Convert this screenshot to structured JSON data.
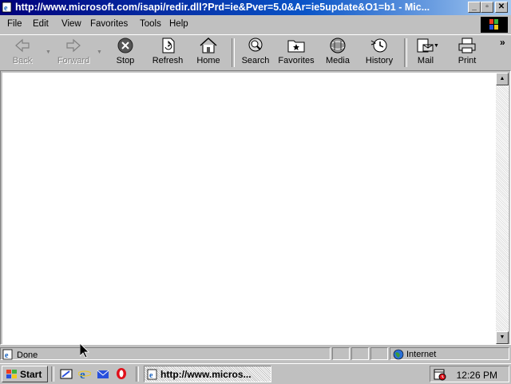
{
  "window": {
    "title": "http://www.microsoft.com/isapi/redir.dll?Prd=ie&Pver=5.0&Ar=ie5update&O1=b1 - Mic...",
    "controls": [
      "minimize",
      "maximize",
      "close"
    ]
  },
  "menu": {
    "items": [
      {
        "label": "File"
      },
      {
        "label": "Edit"
      },
      {
        "label": "View"
      },
      {
        "label": "Favorites"
      },
      {
        "label": "Tools"
      },
      {
        "label": "Help"
      }
    ]
  },
  "toolbar": {
    "buttons": [
      {
        "label": "Back",
        "icon": "back-arrow-icon",
        "enabled": false
      },
      {
        "label": "Forward",
        "icon": "forward-arrow-icon",
        "enabled": false
      },
      {
        "label": "Stop",
        "icon": "stop-icon",
        "enabled": true
      },
      {
        "label": "Refresh",
        "icon": "refresh-icon",
        "enabled": true
      },
      {
        "label": "Home",
        "icon": "home-icon",
        "enabled": true
      },
      {
        "label": "Search",
        "icon": "search-icon",
        "enabled": true
      },
      {
        "label": "Favorites",
        "icon": "favorites-folder-icon",
        "enabled": true
      },
      {
        "label": "Media",
        "icon": "media-icon",
        "enabled": true
      },
      {
        "label": "History",
        "icon": "history-icon",
        "enabled": true
      },
      {
        "label": "Mail",
        "icon": "mail-icon",
        "enabled": true
      },
      {
        "label": "Print",
        "icon": "print-icon",
        "enabled": true
      }
    ],
    "overflow": "»"
  },
  "status": {
    "text": "Done",
    "zone": "Internet"
  },
  "taskbar": {
    "start_label": "Start",
    "task_label": "http://www.micros...",
    "clock": "12:26 PM"
  },
  "colors": {
    "title_gradient_start": "#00007b",
    "title_gradient_end": "#a6caf0",
    "face": "#c0c0c0"
  }
}
